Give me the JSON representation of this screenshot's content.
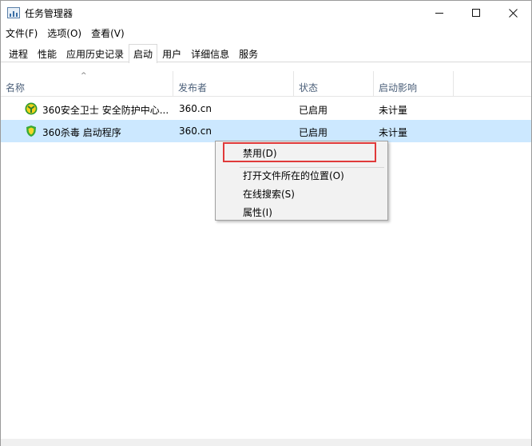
{
  "window": {
    "title": "任务管理器",
    "minimize_icon": "minimize-icon",
    "maximize_icon": "maximize-icon",
    "close_icon": "close-icon"
  },
  "menubar": {
    "items": [
      "文件(F)",
      "选项(O)",
      "查看(V)"
    ]
  },
  "tabs": {
    "items": [
      "进程",
      "性能",
      "应用历史记录",
      "启动",
      "用户",
      "详细信息",
      "服务"
    ],
    "active": "启动"
  },
  "table": {
    "columns": [
      "名称",
      "发布者",
      "状态",
      "启动影响"
    ],
    "sort_indicator": "^",
    "rows": [
      {
        "name": "360安全卫士 安全防护中心...",
        "publisher": "360.cn",
        "status": "已启用",
        "impact": "未计量",
        "icon": "360-safeguard-icon"
      },
      {
        "name": "360杀毒 启动程序",
        "publisher": "360.cn",
        "status": "已启用",
        "impact": "未计量",
        "icon": "360-antivirus-shield-icon"
      }
    ]
  },
  "context_menu": {
    "items": [
      "禁用(D)",
      "打开文件所在的位置(O)",
      "在线搜索(S)",
      "属性(I)"
    ]
  },
  "colors": {
    "selected_row": "#cce8ff",
    "header_text": "#4c607a",
    "highlight_border": "#e03a3a",
    "menu_bg": "#f2f2f2"
  }
}
